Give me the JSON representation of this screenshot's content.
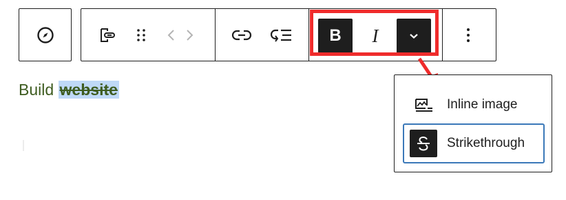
{
  "block_toolbar": {
    "block_type_icon": "compass-icon",
    "buttons": [
      {
        "name": "transform-link-icon"
      },
      {
        "name": "drag-handle-icon"
      },
      {
        "name": "move-arrows-icon"
      },
      {
        "name": "link-icon"
      },
      {
        "name": "navigation-submenu-icon"
      }
    ],
    "format": {
      "bold_label": "B",
      "italic_label": "I",
      "more_icon": "chevron-down-icon"
    },
    "options_icon": "more-vertical-icon",
    "highlight_color": "#ef2b2b"
  },
  "editor": {
    "paragraph_prefix": "Build ",
    "selected_word": "website",
    "text_color": "#3e5c20",
    "selection_color": "#bfd9f7"
  },
  "format_dropdown": {
    "items": [
      {
        "label": "Inline image",
        "icon": "inline-image-icon"
      },
      {
        "label": "Strikethrough",
        "icon": "strikethrough-icon",
        "focused": true
      }
    ],
    "focus_color": "#3a78b8"
  }
}
